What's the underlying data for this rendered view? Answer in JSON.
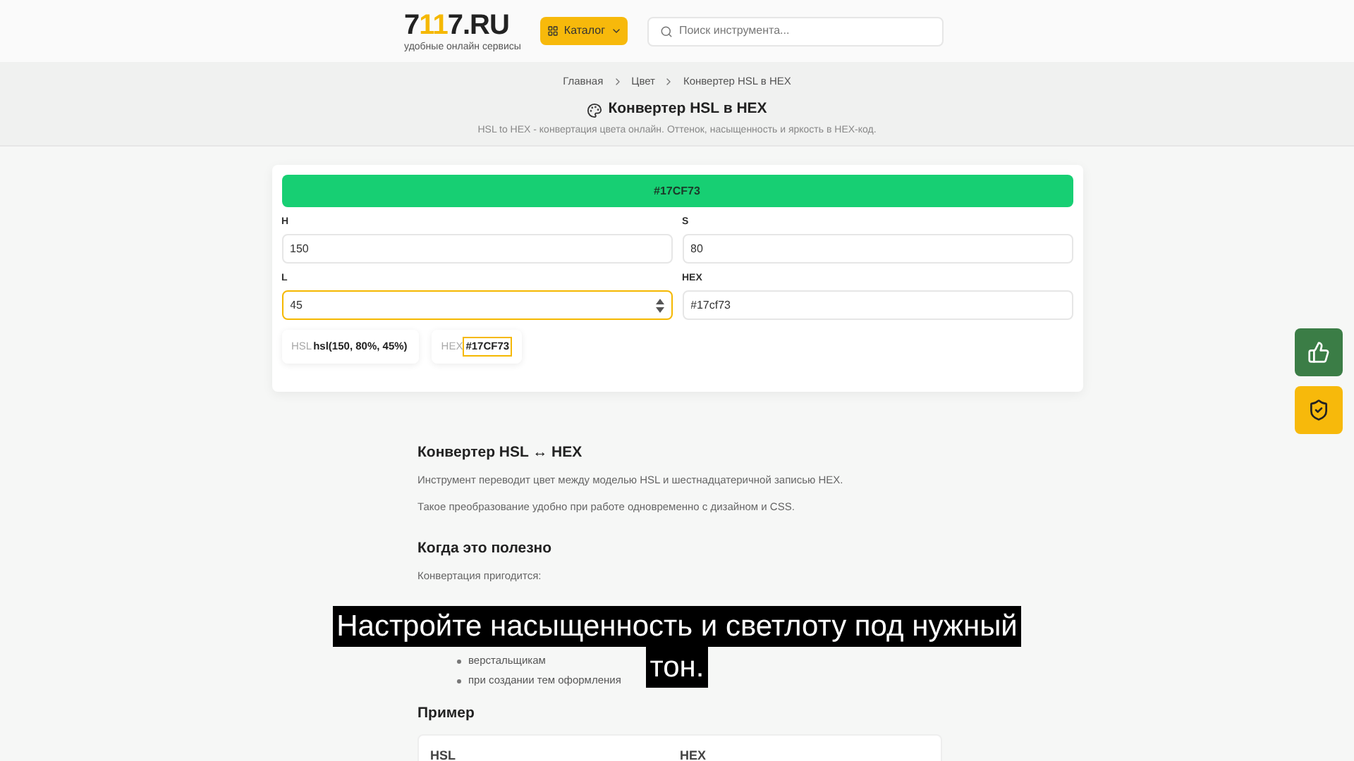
{
  "header": {
    "logo": {
      "prefix": "7",
      "accent": "11",
      "suffix": "7.RU",
      "tagline": "удобные онлайн сервисы"
    },
    "catalog_button": "Каталог",
    "search": {
      "placeholder": "Поиск инструмента..."
    }
  },
  "breadcrumbs": [
    "Главная",
    "Цвет",
    "Конвертер HSL в HEX"
  ],
  "page": {
    "title": "Конвертер HSL в HEX",
    "subtitle": "HSL to HEX - конвертация цвета онлайн. Оттенок, насыщенность и яркость в HEX-код."
  },
  "converter": {
    "preview": {
      "text": "#17CF73",
      "color": "#17cf73"
    },
    "fields": [
      {
        "label": "H",
        "value": "150",
        "focused": false
      },
      {
        "label": "S",
        "value": "80",
        "focused": false
      },
      {
        "label": "L",
        "value": "45",
        "focused": true
      },
      {
        "label": "HEX",
        "value": "#17cf73",
        "focused": false
      }
    ],
    "results": [
      {
        "label": "HSL",
        "value": "hsl(150, 80%, 45%)",
        "selected": false
      },
      {
        "label": "HEX",
        "value": "#17CF73",
        "selected": true
      }
    ]
  },
  "article": [
    {
      "kind": "heading",
      "text": "Конвертер HSL ↔ HEX"
    },
    {
      "kind": "paragraph",
      "text": "Инструмент переводит цвет между моделью HSL и шестнадцатеричной записью HEX."
    },
    {
      "kind": "paragraph",
      "text": "Такое преобразование удобно при работе одновременно с дизайном и CSS."
    },
    {
      "kind": "heading",
      "text": "Когда это полезно"
    },
    {
      "kind": "paragraph",
      "text": "Конвертация пригодится:"
    },
    {
      "kind": "bullets",
      "items": [
        "верстальщикам",
        "при создании тем оформления"
      ]
    },
    {
      "kind": "heading",
      "text": "Пример"
    },
    {
      "kind": "table",
      "columns": [
        "HSL",
        "HEX"
      ]
    }
  ],
  "caption": [
    "Настройте насыщенность и светлоту под нужный",
    "тон."
  ]
}
